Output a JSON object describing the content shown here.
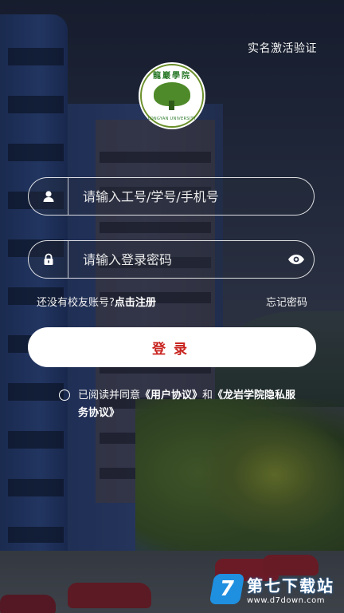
{
  "header": {
    "verify_link": "实名激活验证"
  },
  "logo": {
    "top_text": "龍巖學院",
    "bottom_text": "LONGYAN UNIVERSITY"
  },
  "form": {
    "account_placeholder": "请输入工号/学号/手机号",
    "password_placeholder": "请输入登录密码",
    "no_account_text": "还没有校友账号?",
    "register_label": "点击注册",
    "forgot_label": "忘记密码",
    "login_label": "登录"
  },
  "agreement": {
    "prefix": "已阅读并同意",
    "user_agreement": "《用户协议》",
    "and": "和",
    "privacy": "《龙岩学院隐私服务协议》"
  },
  "watermark": {
    "name": "第七下载站",
    "url": "www.d7down.com",
    "logo_letter": "7"
  },
  "colors": {
    "accent": "#c8231e",
    "field_border": "#ffffff"
  },
  "icons": {
    "user": "user-icon",
    "lock": "lock-icon",
    "eye": "eye-icon"
  }
}
